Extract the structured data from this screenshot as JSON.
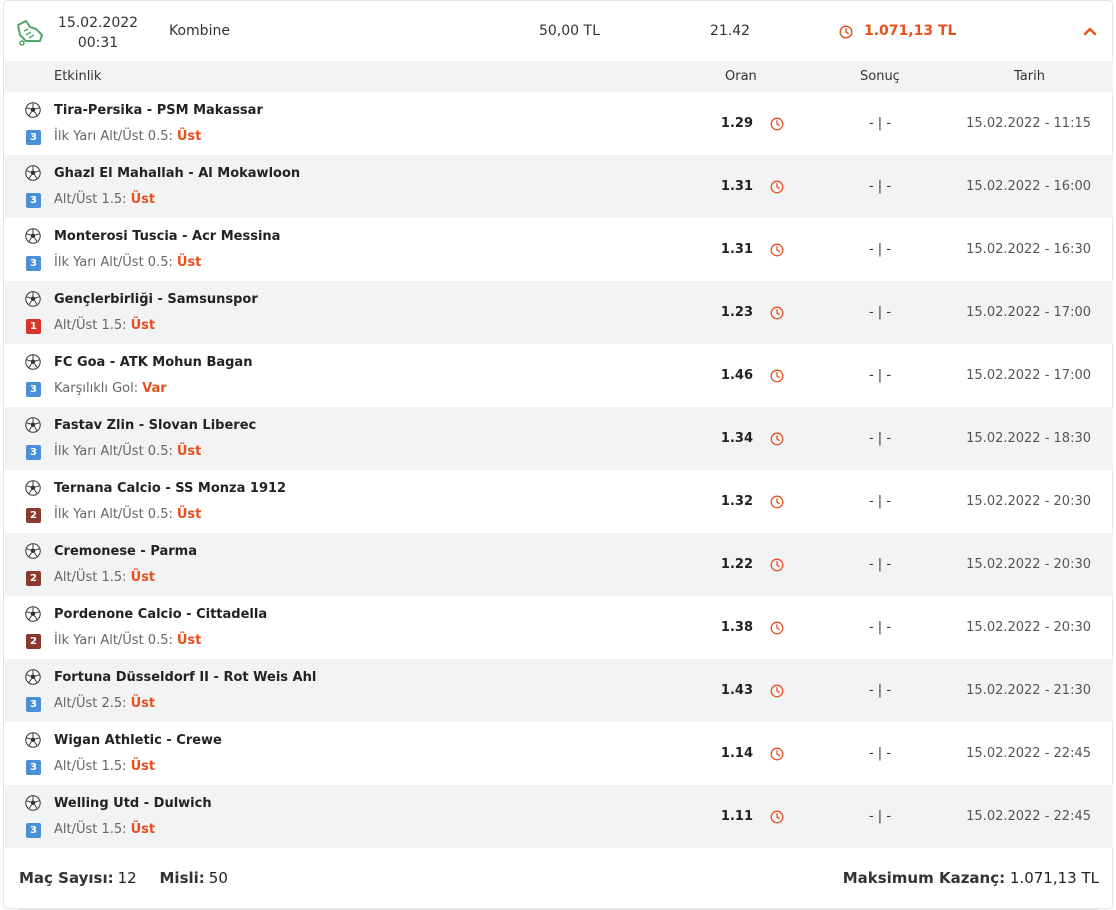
{
  "coupon": {
    "date": "15.02.2022",
    "time": "00:31",
    "type": "Kombine",
    "stake": "50,00 TL",
    "total_odds": "21.42",
    "max_win": "1.071,13 TL",
    "logo_icon": "soccer-boot-icon",
    "collapse_icon": "chevron-up-icon"
  },
  "table": {
    "headers": {
      "event": "Etkinlik",
      "odd": "Oran",
      "result": "Sonuç",
      "date": "Tarih"
    },
    "rows": [
      {
        "match": "Tira-Persika - PSM Makassar",
        "market": "İlk Yarı Alt/Üst 0.5:",
        "pick": "Üst",
        "odd": "1.29",
        "result": "- | -",
        "date": "15.02.2022 - 11:15",
        "badge": "3",
        "badge_color": "#4a90d9"
      },
      {
        "match": "Ghazl El Mahallah - Al Mokawloon",
        "market": "Alt/Üst 1.5:",
        "pick": "Üst",
        "odd": "1.31",
        "result": "- | -",
        "date": "15.02.2022 - 16:00",
        "badge": "3",
        "badge_color": "#4a90d9"
      },
      {
        "match": "Monterosi Tuscia - Acr Messina",
        "market": "İlk Yarı Alt/Üst 0.5:",
        "pick": "Üst",
        "odd": "1.31",
        "result": "- | -",
        "date": "15.02.2022 - 16:30",
        "badge": "3",
        "badge_color": "#4a90d9"
      },
      {
        "match": "Gençlerbirliği - Samsunspor",
        "market": "Alt/Üst 1.5:",
        "pick": "Üst",
        "odd": "1.23",
        "result": "- | -",
        "date": "15.02.2022 - 17:00",
        "badge": "1",
        "badge_color": "#d9342b"
      },
      {
        "match": "FC Goa - ATK Mohun Bagan",
        "market": "Karşılıklı Gol:",
        "pick": "Var",
        "odd": "1.46",
        "result": "- | -",
        "date": "15.02.2022 - 17:00",
        "badge": "3",
        "badge_color": "#4a90d9"
      },
      {
        "match": "Fastav Zlin - Slovan Liberec",
        "market": "İlk Yarı Alt/Üst 0.5:",
        "pick": "Üst",
        "odd": "1.34",
        "result": "- | -",
        "date": "15.02.2022 - 18:30",
        "badge": "3",
        "badge_color": "#4a90d9"
      },
      {
        "match": "Ternana Calcio - SS Monza 1912",
        "market": "İlk Yarı Alt/Üst 0.5:",
        "pick": "Üst",
        "odd": "1.32",
        "result": "- | -",
        "date": "15.02.2022 - 20:30",
        "badge": "2",
        "badge_color": "#8b3a2e"
      },
      {
        "match": "Cremonese - Parma",
        "market": "Alt/Üst 1.5:",
        "pick": "Üst",
        "odd": "1.22",
        "result": "- | -",
        "date": "15.02.2022 - 20:30",
        "badge": "2",
        "badge_color": "#8b3a2e"
      },
      {
        "match": "Pordenone Calcio - Cittadella",
        "market": "İlk Yarı Alt/Üst 0.5:",
        "pick": "Üst",
        "odd": "1.38",
        "result": "- | -",
        "date": "15.02.2022 - 20:30",
        "badge": "2",
        "badge_color": "#8b3a2e"
      },
      {
        "match": "Fortuna Düsseldorf II - Rot Weis Ahl",
        "market": "Alt/Üst 2.5:",
        "pick": "Üst",
        "odd": "1.43",
        "result": "- | -",
        "date": "15.02.2022 - 21:30",
        "badge": "3",
        "badge_color": "#4a90d9"
      },
      {
        "match": "Wigan Athletic - Crewe",
        "market": "Alt/Üst 1.5:",
        "pick": "Üst",
        "odd": "1.14",
        "result": "- | -",
        "date": "15.02.2022 - 22:45",
        "badge": "3",
        "badge_color": "#4a90d9"
      },
      {
        "match": "Welling Utd - Dulwich",
        "market": "Alt/Üst 1.5:",
        "pick": "Üst",
        "odd": "1.11",
        "result": "- | -",
        "date": "15.02.2022 - 22:45",
        "badge": "3",
        "badge_color": "#4a90d9"
      }
    ]
  },
  "footer": {
    "match_count_label": "Maç Sayısı:",
    "match_count": "12",
    "multiplier_label": "Misli:",
    "multiplier": "50",
    "max_win_label": "Maksimum Kazanç:",
    "max_win": "1.071,13 TL"
  },
  "colors": {
    "accent": "#e8501e",
    "row_alt": "#f2f3f5"
  }
}
